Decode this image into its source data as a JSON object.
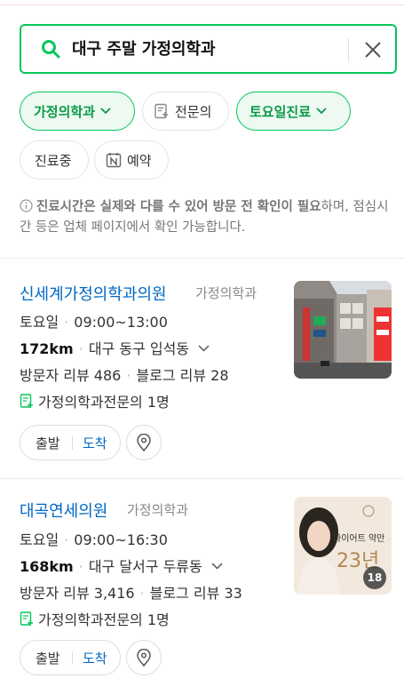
{
  "search": {
    "query": "대구 주말 가정의학과"
  },
  "filters": {
    "specialty": {
      "label": "가정의학과"
    },
    "specialist": {
      "label": "전문의"
    },
    "saturday": {
      "label": "토요일진료"
    },
    "open_now": {
      "label": "진료중"
    },
    "reserve": {
      "label": "예약"
    }
  },
  "notice": {
    "bold": "진료시간은 실제와 다를 수 있어 방문 전 확인이 필요",
    "rest": "하며, 점심시간 등은 업체 페이지에서 확인 가능합니다."
  },
  "results": [
    {
      "name": "신세계가정의학과의원",
      "category": "가정의학과",
      "day": "토요일",
      "hours": "09:00~13:00",
      "distance": "172km",
      "address": "대구 동구 입석동",
      "visitor_reviews": "방문자 리뷰 486",
      "blog_reviews": "블로그 리뷰 28",
      "specialists": "가정의학과전문의 1명",
      "depart": "출발",
      "arrive": "도착"
    },
    {
      "name": "대곡연세의원",
      "category": "가정의학과",
      "day": "토요일",
      "hours": "09:00~16:30",
      "distance": "168km",
      "address": "대구 달서구 두류동",
      "visitor_reviews": "방문자 리뷰 3,416",
      "blog_reviews": "블로그 리뷰 33",
      "specialists": "가정의학과전문의 1명",
      "depart": "출발",
      "arrive": "도착",
      "thumb_text": "다이어트 약만",
      "thumb_big": "23년",
      "thumb_count": "18"
    }
  ],
  "colors": {
    "accent": "#03c75a",
    "link": "#0068c3"
  }
}
